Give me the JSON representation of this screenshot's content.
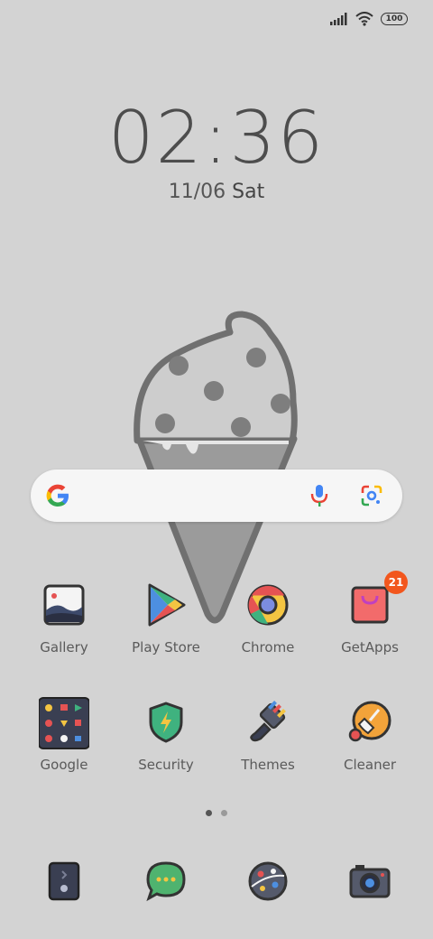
{
  "status": {
    "battery": "100"
  },
  "clock": {
    "time": "02:36",
    "date": "11/06",
    "weekday": "Sat"
  },
  "apps_row1": [
    {
      "label": "Gallery"
    },
    {
      "label": "Play Store"
    },
    {
      "label": "Chrome"
    },
    {
      "label": "GetApps",
      "badge": "21"
    }
  ],
  "apps_row2": [
    {
      "label": "Google"
    },
    {
      "label": "Security"
    },
    {
      "label": "Themes"
    },
    {
      "label": "Cleaner"
    }
  ],
  "pager": {
    "pages": 2,
    "current": 1
  },
  "dock": [
    "phone-icon",
    "messages-icon",
    "browser-icon",
    "camera-icon"
  ]
}
